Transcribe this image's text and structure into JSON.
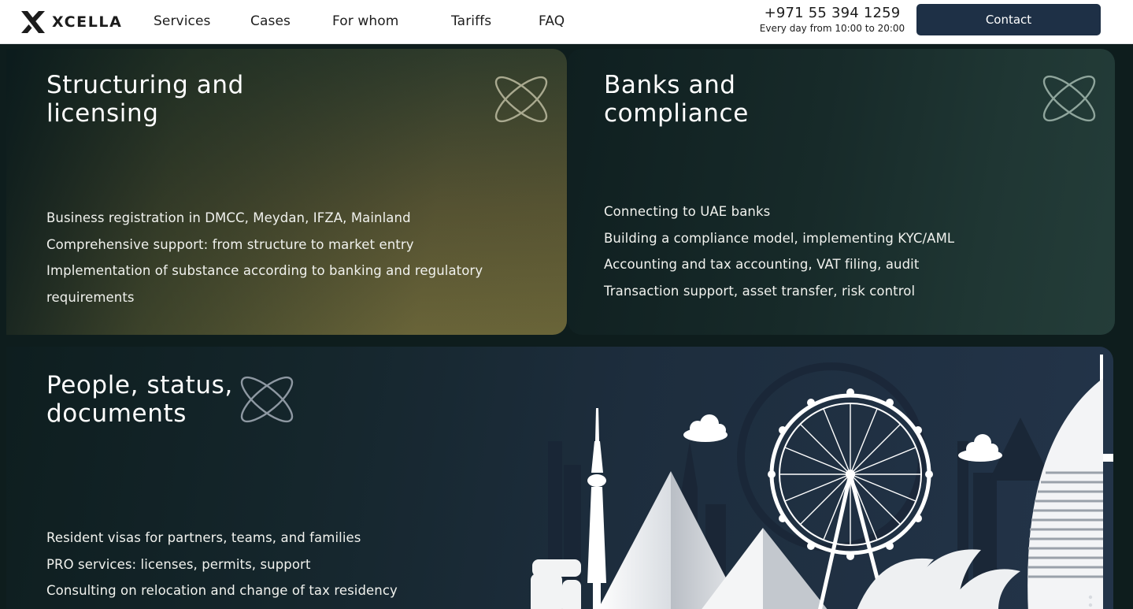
{
  "brand": {
    "name": "XCELLA"
  },
  "nav": [
    {
      "label": "Services"
    },
    {
      "label": "Cases"
    },
    {
      "label": "For whom"
    },
    {
      "label": "Tariffs"
    },
    {
      "label": "FAQ"
    }
  ],
  "contact_info": {
    "phone": "+971 55 394 1259",
    "hours": "Every day from 10:00 to 20:00",
    "button_label": "Contact"
  },
  "cards": [
    {
      "title": "Structuring and\nlicensing",
      "icon": "orbit-icon",
      "items": [
        "Business registration in DMCC, Meydan, IFZA, Mainland",
        "Comprehensive support: from structure to market entry",
        "Implementation of substance according to banking and regulatory",
        "requirements"
      ]
    },
    {
      "title": "Banks and\ncompliance",
      "icon": "orbit-icon",
      "items": [
        "Connecting to UAE banks",
        "Building a compliance model, implementing KYC/AML",
        "Accounting and tax accounting, VAT filing, audit",
        "Transaction support, asset transfer, risk control"
      ]
    },
    {
      "title": "People, status,\ndocuments",
      "icon": "orbit-icon",
      "illustration": "city-skyline-illustration",
      "items": [
        "Resident visas for partners, teams, and families",
        "PRO services: licenses, permits, support",
        "Consulting on relocation and change of tax residency"
      ]
    }
  ],
  "colors": {
    "header_bg": "#ffffff",
    "page_bg": "#0e1d1d",
    "accent_button": "#1e3046",
    "card_olive": "#6a6539",
    "card_teal": "#243d39",
    "card_navy": "#233449"
  }
}
